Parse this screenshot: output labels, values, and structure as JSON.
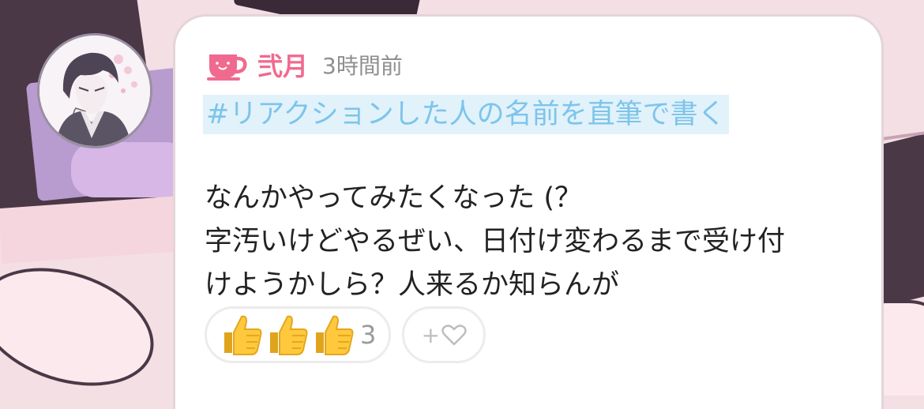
{
  "post": {
    "username": "弐月",
    "timestamp": "3時間前",
    "hashtag": "#リアクションした人の名前を直筆で書く",
    "body_lines": [
      "なんかやってみたくなった (？",
      "字汚いけどやるぜい、日付け変わるまで受け付",
      "けようかしら？人来るか知らんが"
    ]
  },
  "reactions": {
    "emoji": [
      "👍",
      "👍",
      "👍"
    ],
    "count": "3",
    "add_label": "+"
  },
  "icons": {
    "user_icon": "teacup-icon",
    "add_icon": "heart-outline-icon"
  },
  "colors": {
    "username": "#f06a8f",
    "hashtag_text": "#7ec4ea",
    "hashtag_bg": "#e1f2fb",
    "timestamp": "#8f8f8f"
  }
}
